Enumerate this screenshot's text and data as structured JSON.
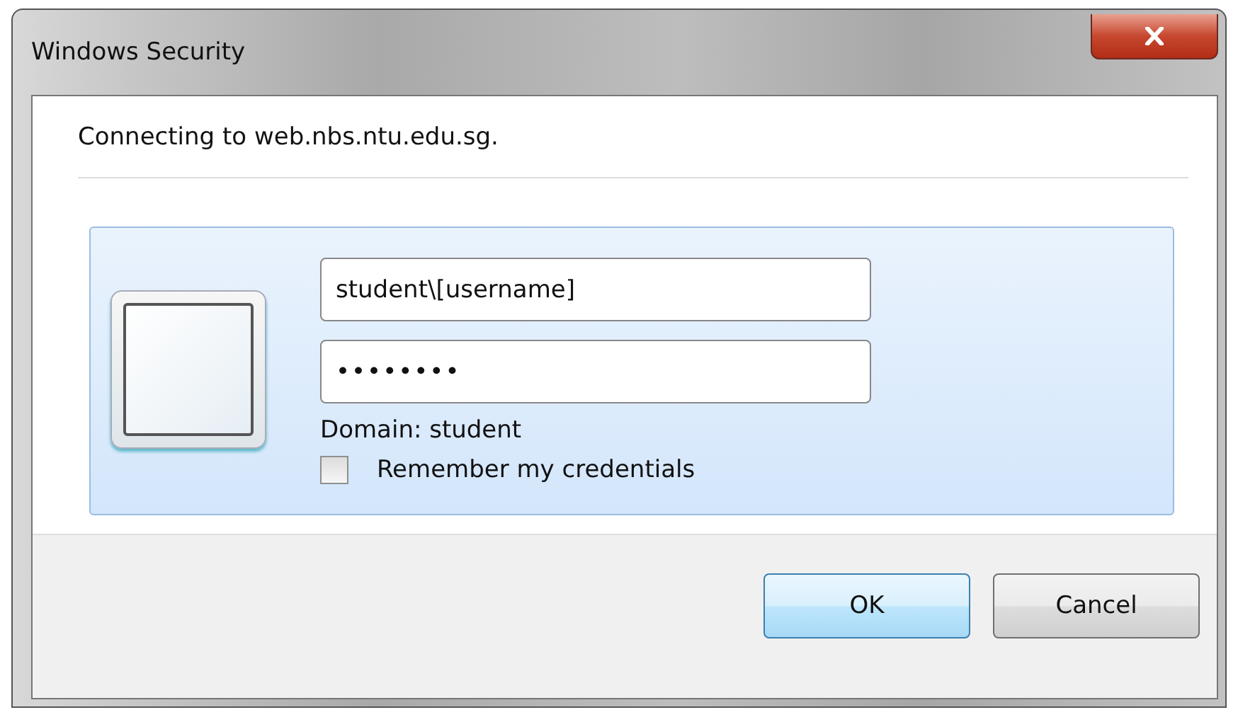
{
  "window": {
    "title": "Windows Security"
  },
  "message": "Connecting to web.nbs.ntu.edu.sg.",
  "credentials": {
    "username": "student\\[username]",
    "password": "••••••••",
    "domain": "Domain: student",
    "remember": {
      "label": "Remember my credentials",
      "checked": false
    }
  },
  "buttons": [
    {
      "label": "OK",
      "default": true
    },
    {
      "label": "Cancel",
      "default": false
    }
  ]
}
